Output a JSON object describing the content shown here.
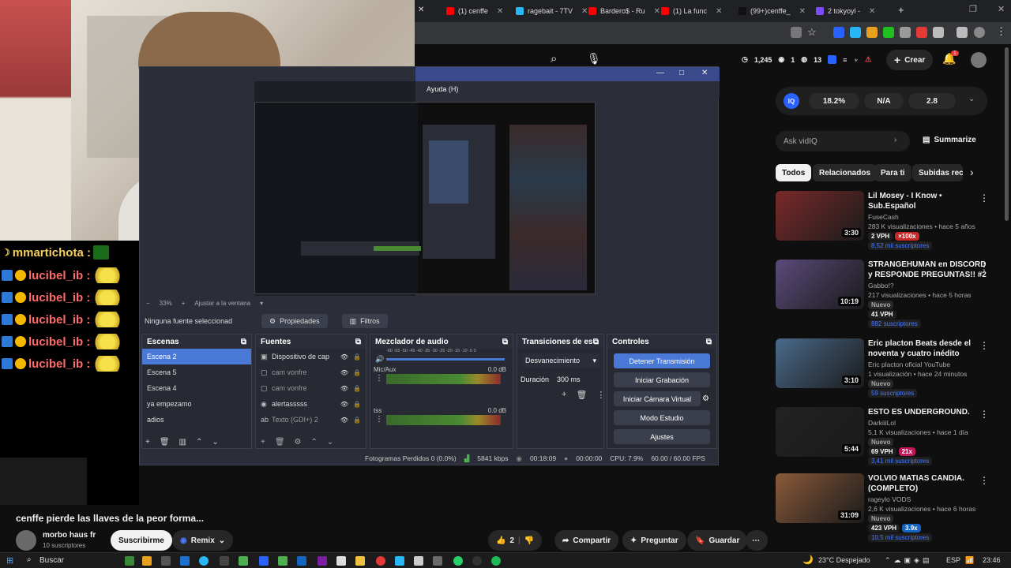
{
  "tabs": [
    {
      "label": "(1) cenffe",
      "color": "#ff0000"
    },
    {
      "label": "ragebait - 7TV",
      "color": "#29b6f6"
    },
    {
      "label": "Bardero$ - Ru",
      "color": "#ff0000"
    },
    {
      "label": "(1) La func",
      "color": "#ff0000"
    },
    {
      "label": "(99+)cenffe_",
      "color": "#111111"
    },
    {
      "label": "2 tokyoyl -",
      "color": "#7c4dff"
    }
  ],
  "yt_header": {
    "views": "1,245",
    "likes": "1",
    "dislikes": "13",
    "create_label": "Crear",
    "notif_count": "1"
  },
  "chat": {
    "first": {
      "user": "mmartichota :"
    },
    "repeat_user": "lucibel_ib :",
    "repeat_count": 5
  },
  "obs": {
    "menu_help": "Ayuda (H)",
    "zoom": "33%",
    "fit": "Ajustar a la ventana",
    "no_source": "Ninguna fuente seleccionad",
    "props": "Propiedades",
    "filters": "Filtros",
    "scenes_title": "Escenas",
    "scenes": [
      "Escena 2",
      "Escena 5",
      "Escena 4",
      "ya empezamo",
      "adios"
    ],
    "sources_title": "Fuentes",
    "sources": [
      "Dispositivo de cap",
      "cam vonfre",
      "cam vonfre",
      "alertasssss",
      "Texto (GDI+) 2"
    ],
    "mixer_title": "Mezclador de audio",
    "mixer": [
      {
        "name": "Mic/Aux",
        "db": "0.0 dB"
      },
      {
        "name": "tss",
        "db": "0.0 dB"
      }
    ],
    "scale": "-60 -55 -50 -45 -40 -35 -30 -25 -20 -15 -10 -5 0",
    "trans_title": "Transiciones de es...",
    "transition": "Desvanecimiento",
    "duration_label": "Duración",
    "duration": "300 ms",
    "controls_title": "Controles",
    "controls": [
      "Detener Transmisión",
      "Iniciar Grabación",
      "Iniciar Cámara Virtual",
      "Modo Estudio",
      "Ajustes"
    ],
    "status": {
      "dropped": "Fotogramas Perdidos 0 (0.0%)",
      "kbps": "5841 kbps",
      "live": "00:18:09",
      "rec": "00:00:00",
      "cpu": "CPU: 7.9%",
      "fps": "60.00 / 60.00 FPS"
    }
  },
  "vidiq": {
    "score1": "18.2%",
    "score2": "N/A",
    "score3": "2.8",
    "ask": "Ask vidIQ",
    "summarize": "Summarize"
  },
  "chips": [
    "Todos",
    "Relacionados",
    "Para ti",
    "Subidas rec"
  ],
  "videos": [
    {
      "title": "Lil Mosey - I Know • Sub.Español",
      "channel": "FuseCash",
      "stats": "283 K visualizaciones • hace 5 años",
      "vph": "2 VPH",
      "mult": "×100x",
      "subs": "8,52 mil suscriptores",
      "duration": "3:30",
      "thumb": "#7a2a2a"
    },
    {
      "title": "STRANGEHUMAN en DISCORD y RESPONDE PREGUNTAS!! #2",
      "channel": "Gabbo!?",
      "stats": "217 visualizaciones • hace 5 horas",
      "badge": "Nuevo",
      "vph": "41 VPH",
      "mult": "",
      "subs": "882 suscriptores",
      "duration": "10:19",
      "thumb": "#5a4a7a"
    },
    {
      "title": "Eric placton Beats desde el noventa y cuatro inédito",
      "channel": "Eric placton oficial YouTube",
      "stats": "1 visualización • hace 24 minutos",
      "badge": "Nuevo",
      "vph": "",
      "mult": "",
      "subs": "59 suscriptores",
      "duration": "3:10",
      "thumb": "#4a6a8a"
    },
    {
      "title": "ESTO ES UNDERGROUND.",
      "channel": "DarkiiiLol",
      "stats": "5,1 K visualizaciones • hace 1 día",
      "badge": "Nuevo",
      "vph": "69 VPH",
      "mult": "21x",
      "subs": "3,41 mil suscriptores",
      "duration": "5:44",
      "thumb": "#222222"
    },
    {
      "title": "VOLVIO MATIAS CANDIA. (COMPLETO)",
      "channel": "rageylo VODS",
      "stats": "2,6 K visualizaciones • hace 6 horas",
      "badge": "Nuevo",
      "vph": "423 VPH",
      "mult": "3.9x",
      "subs": "10,5 mil suscriptores",
      "duration": "31:09",
      "thumb": "#8a5a3a"
    }
  ],
  "video": {
    "title": "cenffe pierde las llaves de la peor forma...",
    "channel": "morbo haus fr",
    "subs": "10 suscriptores",
    "subscribe": "Suscribirme",
    "remix": "Remix",
    "likes": "2",
    "share": "Compartir",
    "ask": "Preguntar",
    "save": "Guardar"
  },
  "taskbar": {
    "search": "Buscar",
    "weather": "23°C Despejado",
    "lang": "ESP",
    "time": "23:46"
  }
}
